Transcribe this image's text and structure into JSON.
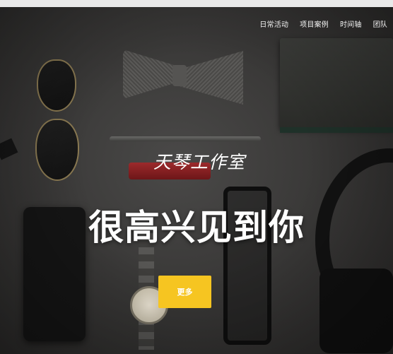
{
  "nav": {
    "items": [
      {
        "label": "日常活动"
      },
      {
        "label": "项目案例"
      },
      {
        "label": "时间轴"
      },
      {
        "label": "团队"
      }
    ]
  },
  "hero": {
    "subtitle": "天琴工作室",
    "headline": "很高兴见到你",
    "button_label": "更多"
  },
  "colors": {
    "accent": "#f6c521",
    "text": "#ffffff",
    "background": "#3a3938"
  }
}
